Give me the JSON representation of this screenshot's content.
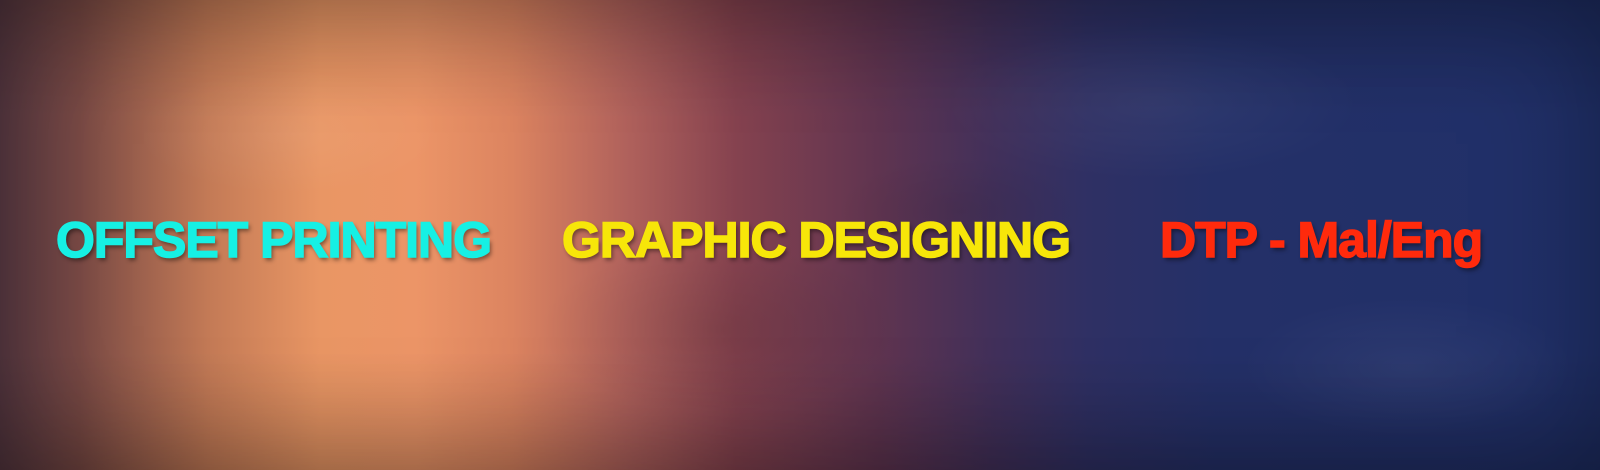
{
  "banner": {
    "services": [
      {
        "label": "OFFSET PRINTING",
        "color": "#16f0e4"
      },
      {
        "label": "GRAPHIC DESIGNING",
        "color": "#f7e609"
      },
      {
        "label": "DTP - Mal/Eng",
        "color": "#ff2a0c"
      }
    ]
  }
}
